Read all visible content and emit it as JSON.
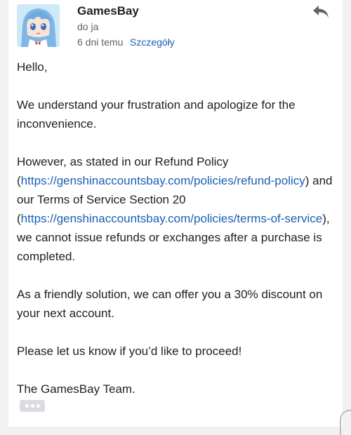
{
  "header": {
    "sender_name": "GamesBay",
    "recipient": "do ja",
    "date": "6 dni temu",
    "details_link": "Szczegóły"
  },
  "icons": {
    "avatar": "anime-avatar",
    "reply": "reply-icon",
    "more": "ellipsis-icon"
  },
  "colors": {
    "link": "#1a5fb4",
    "text": "#202124",
    "secondary_text": "#5f6368",
    "background": "#f1f1f1"
  },
  "message": {
    "greeting": "Hello,",
    "para1": "We understand your frustration and apologize for the inconvenience.",
    "para2_part1": "However, as stated in our Refund Policy (",
    "refund_policy_url": "https://genshinaccountsbay.com/policies/refund-policy",
    "para2_part2": ") and our Terms of Service Section 20 (",
    "terms_url": "https://genshinaccountsbay.com/policies/terms-of-service",
    "para2_part3": "), we cannot issue refunds or exchanges after a purchase is completed.",
    "para3": "As a friendly solution, we can offer you a 30% discount on your next account.",
    "para4": "Please let us know if you’d like to proceed!",
    "signature": "The GamesBay Team."
  }
}
